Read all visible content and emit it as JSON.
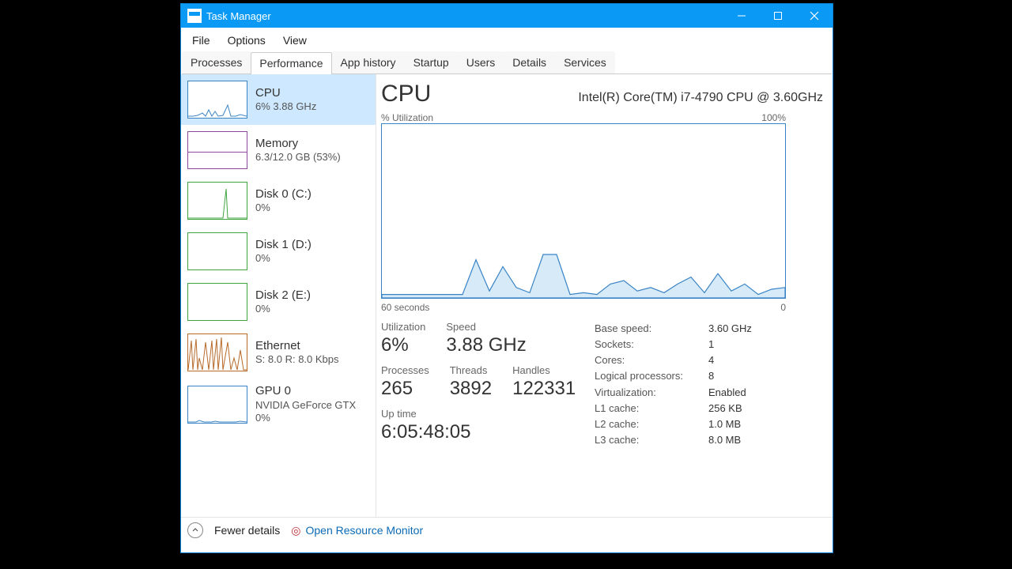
{
  "window": {
    "title": "Task Manager"
  },
  "menu": {
    "file": "File",
    "options": "Options",
    "view": "View"
  },
  "tabs": {
    "processes": "Processes",
    "performance": "Performance",
    "app_history": "App history",
    "startup": "Startup",
    "users": "Users",
    "details": "Details",
    "services": "Services"
  },
  "sidebar": {
    "items": [
      {
        "title": "CPU",
        "sub": "6%  3.88 GHz"
      },
      {
        "title": "Memory",
        "sub": "6.3/12.0 GB (53%)"
      },
      {
        "title": "Disk 0 (C:)",
        "sub": "0%"
      },
      {
        "title": "Disk 1 (D:)",
        "sub": "0%"
      },
      {
        "title": "Disk 2 (E:)",
        "sub": "0%"
      },
      {
        "title": "Ethernet",
        "sub": "S: 8.0  R: 8.0 Kbps"
      },
      {
        "title": "GPU 0",
        "sub": "NVIDIA GeForce GTX",
        "sub2": "0%"
      }
    ]
  },
  "detail": {
    "title": "CPU",
    "model": "Intel(R) Core(TM) i7-4790 CPU @ 3.60GHz",
    "chart_top_left": "% Utilization",
    "chart_top_right": "100%",
    "chart_bot_left": "60 seconds",
    "chart_bot_right": "0",
    "stats": {
      "util_label": "Utilization",
      "util_value": "6%",
      "speed_label": "Speed",
      "speed_value": "3.88 GHz",
      "proc_label": "Processes",
      "proc_value": "265",
      "thr_label": "Threads",
      "thr_value": "3892",
      "hnd_label": "Handles",
      "hnd_value": "122331",
      "up_label": "Up time",
      "up_value": "6:05:48:05"
    },
    "specs": {
      "base_k": "Base speed:",
      "base_v": "3.60 GHz",
      "sock_k": "Sockets:",
      "sock_v": "1",
      "core_k": "Cores:",
      "core_v": "4",
      "lp_k": "Logical processors:",
      "lp_v": "8",
      "virt_k": "Virtualization:",
      "virt_v": "Enabled",
      "l1_k": "L1 cache:",
      "l1_v": "256 KB",
      "l2_k": "L2 cache:",
      "l2_v": "1.0 MB",
      "l3_k": "L3 cache:",
      "l3_v": "8.0 MB"
    }
  },
  "footer": {
    "fewer": "Fewer details",
    "orm": "Open Resource Monitor"
  },
  "chart_data": {
    "type": "area",
    "title": "% Utilization",
    "xlabel": "60 seconds → 0",
    "ylabel": "% Utilization",
    "ylim": [
      0,
      100
    ],
    "x_seconds": [
      60,
      58,
      56,
      54,
      52,
      50,
      48,
      46,
      44,
      42,
      40,
      38,
      36,
      34,
      32,
      30,
      28,
      26,
      24,
      22,
      20,
      18,
      16,
      14,
      12,
      10,
      8,
      6,
      4,
      2,
      0
    ],
    "values": [
      2,
      2,
      2,
      2,
      2,
      2,
      2,
      22,
      4,
      18,
      6,
      3,
      25,
      25,
      2,
      3,
      2,
      8,
      10,
      4,
      6,
      3,
      8,
      12,
      3,
      14,
      4,
      8,
      2,
      5,
      6
    ]
  }
}
